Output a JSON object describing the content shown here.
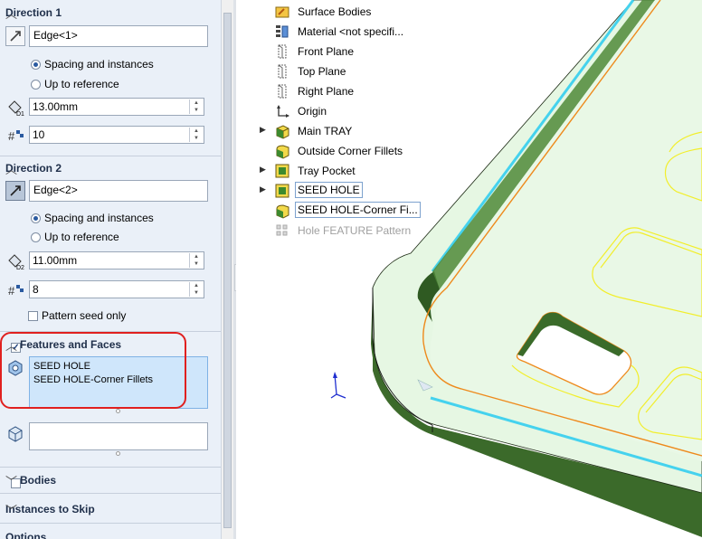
{
  "panel": {
    "direction1": {
      "title": "Direction 1",
      "edge_value": "Edge<1>",
      "option_spacing": "Spacing and instances",
      "option_reference": "Up to reference",
      "spacing_value": "13.00mm",
      "instances_value": "10"
    },
    "direction2": {
      "title": "Direction 2",
      "edge_value": "Edge<2>",
      "option_spacing": "Spacing and instances",
      "option_reference": "Up to reference",
      "spacing_value": "11.00mm",
      "instances_value": "8",
      "pattern_seed_only": "Pattern seed only"
    },
    "features_faces": {
      "title": "Features and Faces",
      "items": [
        "SEED HOLE",
        "SEED HOLE-Corner Fillets"
      ]
    },
    "bodies": {
      "title": "Bodies"
    },
    "instances_to_skip": {
      "title": "Instances to Skip"
    },
    "options": {
      "title": "Options"
    },
    "icon_d1": "D1",
    "icon_d2": "D2"
  },
  "tree": {
    "items": [
      {
        "label": "Surface Bodies",
        "icon": "surface-bodies-folder-icon"
      },
      {
        "label": "Material <not specifi...",
        "icon": "material-icon"
      },
      {
        "label": "Front Plane",
        "icon": "plane-icon"
      },
      {
        "label": "Top Plane",
        "icon": "plane-icon"
      },
      {
        "label": "Right Plane",
        "icon": "plane-icon"
      },
      {
        "label": "Origin",
        "icon": "origin-icon"
      },
      {
        "label": "Main TRAY",
        "icon": "extrude-icon"
      },
      {
        "label": "Outside Corner Fillets",
        "icon": "fillet-icon"
      },
      {
        "label": "Tray Pocket",
        "icon": "cut-extrude-icon"
      },
      {
        "label": "SEED HOLE",
        "icon": "cut-extrude-icon"
      },
      {
        "label": "SEED HOLE-Corner Fi...",
        "icon": "fillet-icon"
      },
      {
        "label": "Hole FEATURE Pattern",
        "icon": "linear-pattern-icon"
      }
    ]
  },
  "colors": {
    "panel_bg": "#eaf0f8",
    "selection_blue": "#cfe6fb",
    "highlight_red": "#e0201f",
    "part_face": "#e6f7e3",
    "part_edge_green": "#3e6b2c",
    "preview_yellow": "#f2ee2a",
    "preview_orange": "#ee8a1c"
  }
}
